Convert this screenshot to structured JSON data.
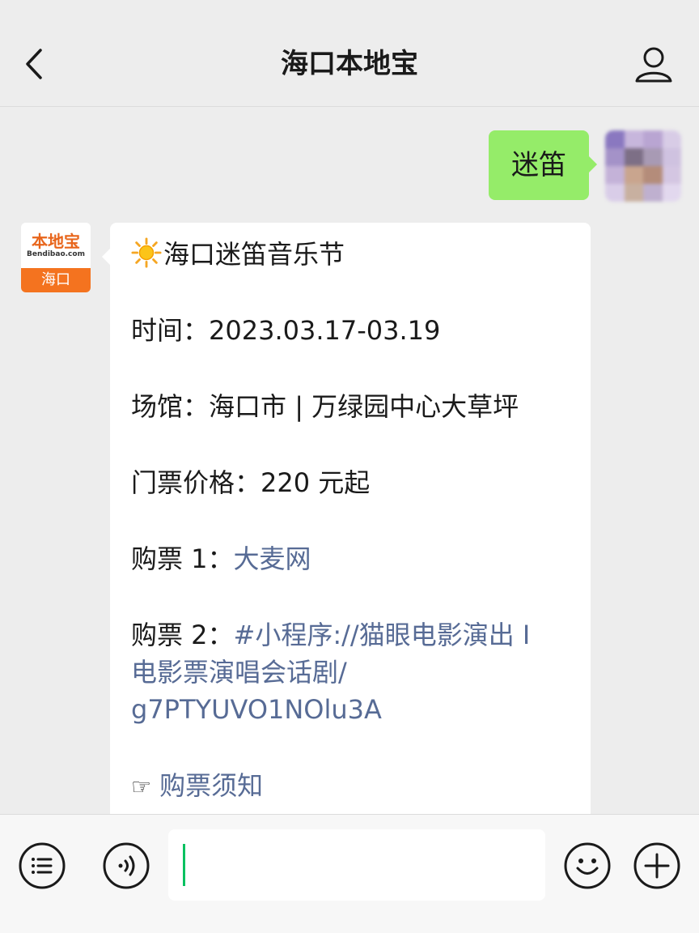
{
  "header": {
    "title": "海口本地宝",
    "back_icon": "chevron-left-icon",
    "profile_icon": "person-icon"
  },
  "outgoing": {
    "text": "迷笛"
  },
  "bot": {
    "avatar_logo": "本地宝",
    "avatar_sub": "Bendibao.com",
    "avatar_city": "海口"
  },
  "message": {
    "title_icon": "sun-icon",
    "title": "海口迷笛音乐节",
    "time_label": "时间：",
    "time_value": "2023.03.17-03.19",
    "venue_label": "场馆：",
    "venue_value": "海口市 | 万绿园中心大草坪",
    "price_label": "门票价格：",
    "price_value": "220 元起",
    "ticket1_label": "购票 1：",
    "ticket1_link": "大麦网",
    "ticket2_label": "购票 2：",
    "ticket2_link_a": "#小程序://猫眼电影演出 I",
    "ticket2_link_b": "电影票演唱会话剧/",
    "ticket2_link_c": "g7PTYUVO1NOlu3A",
    "notice_icon": "pointing-hand-icon",
    "notice_link": "购票须知"
  },
  "input_bar": {
    "menu_icon": "list-icon",
    "voice_icon": "voice-icon",
    "emoji_icon": "smiley-icon",
    "plus_icon": "plus-icon"
  },
  "colors": {
    "background": "#ededed",
    "outgoing_bubble": "#95ec69",
    "link": "#576b95",
    "brand_orange": "#f4731f",
    "caret": "#07c160"
  }
}
